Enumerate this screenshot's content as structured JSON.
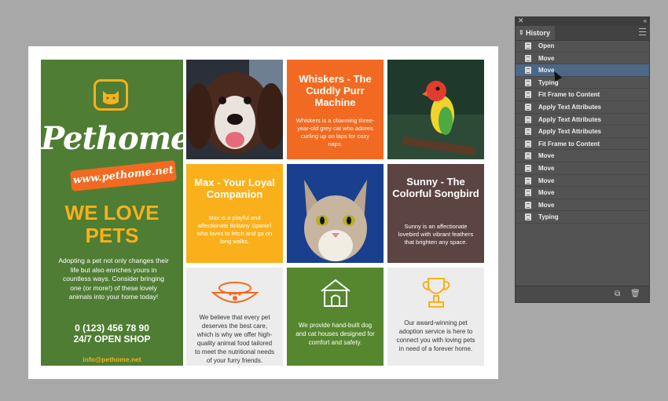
{
  "flyer": {
    "brand": "Pethome",
    "website": "www.pethome.net",
    "headline_line1": "WE LOVE",
    "headline_line2": "PETS",
    "blurb": "Adopting a pet not only changes their life but also enriches yours in countless ways. Consider bringing one (or more!) of these lovely animals into your home today!",
    "phone": "0 (123) 456 78 90",
    "hours": "24/7 OPEN SHOP",
    "email": "info@pethome.net",
    "cards": {
      "whiskers": {
        "title": "Whiskers - The Cuddly Purr Machine",
        "text": "Whiskers is a charming three-year-old grey cat who adores curling up on laps for cozy naps."
      },
      "max": {
        "title": "Max - Your Loyal Companion",
        "text": "Max is a playful and affectionate Brittany Spaniel who loves to fetch and go on long walks."
      },
      "sunny": {
        "title": "Sunny - The Colorful Songbird",
        "text": "Sunny is an affectionate lovebird with vibrant feathers that brighten any space."
      },
      "food": {
        "icon": "pet-food-bowl-icon",
        "text": "We believe that every pet deserves the best care, which is why we offer high-quality animal food tailored to meet the nutritional needs of your furry friends."
      },
      "houses": {
        "icon": "dog-house-icon",
        "text": "We provide hand-built dog and cat houses designed for comfort and safety."
      },
      "adoption": {
        "icon": "trophy-icon",
        "text": "Our award-winning pet adoption service is here to connect you with loving pets in need of a forever home."
      }
    },
    "photos": [
      "dog-photo",
      "cat-photo",
      "bird-photo"
    ]
  },
  "history_panel": {
    "tab": "History",
    "selected_index": 2,
    "items": [
      "Open",
      "Move",
      "Move",
      "Typing",
      "Fit Frame to Content",
      "Apply Text Attributes",
      "Apply Text Attributes",
      "Apply Text Attributes",
      "Fit Frame to Content",
      "Move",
      "Move",
      "Move",
      "Move",
      "Move",
      "Typing"
    ]
  },
  "colors": {
    "green": "#56872f",
    "orange": "#f26a21",
    "yellow": "#f9b01b",
    "brown": "#5c4443",
    "selection": "#4c6888"
  }
}
